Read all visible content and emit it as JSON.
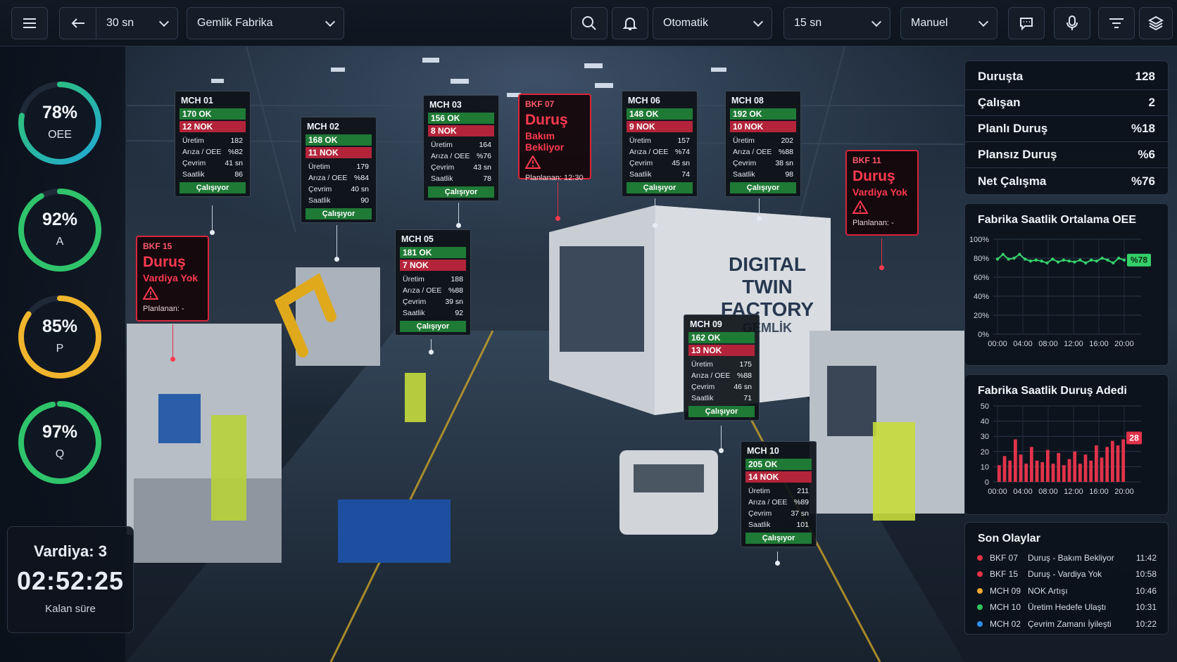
{
  "topbar": {
    "interval": "30 sn",
    "factory": "Gemlik Fabrika",
    "mode": "Otomatik",
    "refresh": "15 sn",
    "control": "Manuel"
  },
  "kpis": [
    {
      "value": "78%",
      "label": "OEE",
      "fraction": 0.78,
      "color": "#2fc46b",
      "color2": "#22a9d6"
    },
    {
      "value": "92%",
      "label": "A",
      "fraction": 0.92,
      "color": "#2fc46b"
    },
    {
      "value": "85%",
      "label": "P",
      "fraction": 0.85,
      "color": "#f0b52c"
    },
    {
      "value": "97%",
      "label": "Q",
      "fraction": 0.97,
      "color": "#2fc46b"
    }
  ],
  "shift": {
    "title": "Vardiya: 3",
    "remaining": "02:52:25",
    "caption": "Kalan süre"
  },
  "machines": {
    "m01": {
      "name": "MCH 01",
      "ok": "170 OK",
      "nok": "12 NOK",
      "uretim": "182",
      "oee": "%82",
      "cevrim": "41 sn",
      "saatlik": "86",
      "status": "Çalışıyor"
    },
    "m02": {
      "name": "MCH 02",
      "ok": "168 OK",
      "nok": "11 NOK",
      "uretim": "179",
      "oee": "%84",
      "cevrim": "40 sn",
      "saatlik": "90",
      "status": "Çalışıyor"
    },
    "m03": {
      "name": "MCH 03",
      "ok": "156 OK",
      "nok": "8 NOK",
      "uretim": "164",
      "oee": "%76",
      "cevrim": "43 sn",
      "saatlik": "78",
      "status": "Çalışıyor"
    },
    "m05": {
      "name": "MCH 05",
      "ok": "181 OK",
      "nok": "7 NOK",
      "uretim": "188",
      "oee": "%88",
      "cevrim": "39 sn",
      "saatlik": "92",
      "status": "Çalışıyor"
    },
    "m06": {
      "name": "MCH 06",
      "ok": "148 OK",
      "nok": "9 NOK",
      "uretim": "157",
      "oee": "%74",
      "cevrim": "45 sn",
      "saatlik": "74",
      "status": "Çalışıyor"
    },
    "m08": {
      "name": "MCH 08",
      "ok": "192 OK",
      "nok": "10 NOK",
      "uretim": "202",
      "oee": "%88",
      "cevrim": "38 sn",
      "saatlik": "98",
      "status": "Çalışıyor"
    },
    "m09": {
      "name": "MCH 09",
      "ok": "162 OK",
      "nok": "13 NOK",
      "uretim": "175",
      "oee": "%88",
      "cevrim": "46 sn",
      "saatlik": "71",
      "status": "Çalışıyor"
    },
    "m10": {
      "name": "MCH 10",
      "ok": "205 OK",
      "nok": "14 NOK",
      "uretim": "211",
      "oee": "%89",
      "cevrim": "37 sn",
      "saatlik": "101",
      "status": "Çalışıyor"
    }
  },
  "row_labels": {
    "uretim": "Üretim",
    "oee": "Arıza / OEE",
    "cevrim": "Çevrim",
    "saatlik": "Saatlik"
  },
  "stops": {
    "b07": {
      "name": "BKF 07",
      "state": "Duruş",
      "reason": "Bakım Bekliyor",
      "plan": "Planlanan: 12:30"
    },
    "b15": {
      "name": "BKF 15",
      "state": "Duruş",
      "reason": "Vardiya Yok",
      "plan": "Planlanan: -"
    },
    "b11": {
      "name": "BKF 11",
      "state": "Duruş",
      "reason": "Vardiya Yok",
      "plan": "Planlanan: -"
    }
  },
  "sign": {
    "line1": "DIGITAL TWIN",
    "line2": "FACTORY",
    "line3": "GEMLİK"
  },
  "stats": [
    {
      "label": "Duruşta",
      "value": "128"
    },
    {
      "label": "Çalışan",
      "value": "2"
    },
    {
      "label": "Planlı Duruş",
      "value": "%18"
    },
    {
      "label": "Plansız Duruş",
      "value": "%6"
    },
    {
      "label": "Net Çalışma",
      "value": "%76"
    }
  ],
  "chart_data": [
    {
      "type": "line",
      "title": "Fabrika Saatlik Ortalama OEE",
      "x_ticks": [
        "00:00",
        "04:00",
        "08:00",
        "12:00",
        "16:00",
        "20:00"
      ],
      "y_ticks": [
        "0%",
        "20%",
        "40%",
        "60%",
        "80%",
        "100%"
      ],
      "ylim": [
        0,
        100
      ],
      "xlim": [
        0,
        23
      ],
      "values": [
        79,
        84,
        79,
        80,
        84,
        79,
        77,
        78,
        77,
        75,
        79,
        76,
        78,
        77,
        76,
        78,
        75,
        78,
        77,
        80,
        78,
        75,
        80,
        78
      ],
      "end_label": "%78",
      "color": "#35d06a"
    },
    {
      "type": "bar",
      "title": "Fabrika Saatlik Duruş Adedi",
      "x_ticks": [
        "00:00",
        "04:00",
        "08:00",
        "12:00",
        "16:00",
        "20:00"
      ],
      "y_ticks": [
        "0",
        "10",
        "20",
        "30",
        "40",
        "50"
      ],
      "ylim": [
        0,
        50
      ],
      "values": [
        11,
        17,
        14,
        28,
        18,
        12,
        23,
        14,
        13,
        21,
        12,
        19,
        11,
        15,
        20,
        12,
        18,
        14,
        24,
        16,
        23,
        27,
        24,
        28
      ],
      "end_label": "28",
      "color": "#e2334a"
    }
  ],
  "events": {
    "title": "Son Olaylar",
    "items": [
      {
        "code": "BKF 07",
        "desc": "Duruş - Bakım Bekliyor",
        "time": "11:42",
        "color": "#e23344"
      },
      {
        "code": "BKF 15",
        "desc": "Duruş - Vardiya Yok",
        "time": "10:58",
        "color": "#e23344"
      },
      {
        "code": "MCH 09",
        "desc": "NOK Artışı",
        "time": "10:46",
        "color": "#f0a830"
      },
      {
        "code": "MCH 10",
        "desc": "Üretim Hedefe Ulaştı",
        "time": "10:31",
        "color": "#32c55c"
      },
      {
        "code": "MCH 02",
        "desc": "Çevrim Zamanı İyileşti",
        "time": "10:22",
        "color": "#2f8fe6"
      }
    ]
  }
}
